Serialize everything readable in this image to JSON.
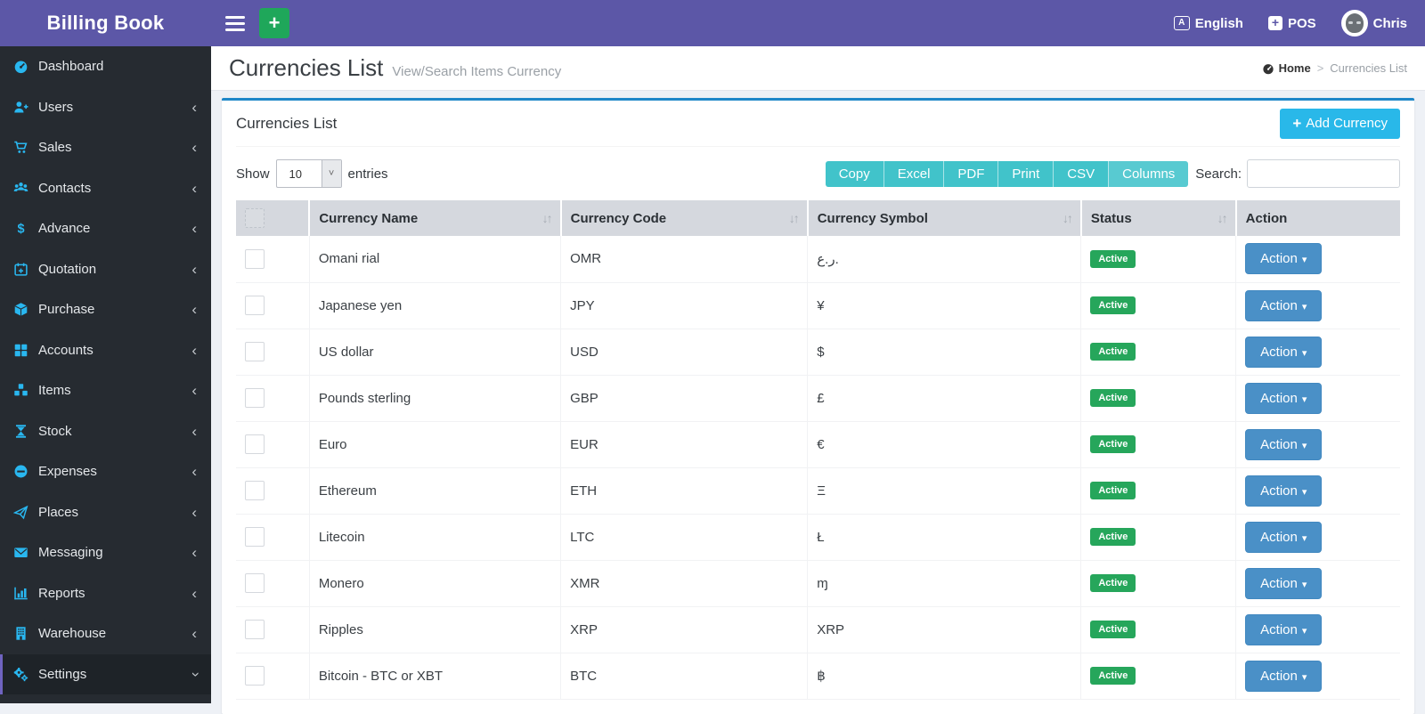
{
  "brand": {
    "title": "Billing Book"
  },
  "navbar": {
    "language_label": "English",
    "pos_label": "POS",
    "user_name": "Chris"
  },
  "sidebar": {
    "items": [
      {
        "label": "Dashboard",
        "icon": "tachometer",
        "chevron": "none",
        "active": false
      },
      {
        "label": "Users",
        "icon": "user-plus",
        "chevron": "left",
        "active": false
      },
      {
        "label": "Sales",
        "icon": "cart",
        "chevron": "left",
        "active": false
      },
      {
        "label": "Contacts",
        "icon": "users",
        "chevron": "left",
        "active": false
      },
      {
        "label": "Advance",
        "icon": "dollar",
        "chevron": "left",
        "active": false
      },
      {
        "label": "Quotation",
        "icon": "calendar-plus",
        "chevron": "left",
        "active": false
      },
      {
        "label": "Purchase",
        "icon": "cube",
        "chevron": "left",
        "active": false
      },
      {
        "label": "Accounts",
        "icon": "grid",
        "chevron": "left",
        "active": false
      },
      {
        "label": "Items",
        "icon": "cubes",
        "chevron": "left",
        "active": false
      },
      {
        "label": "Stock",
        "icon": "hourglass",
        "chevron": "left",
        "active": false
      },
      {
        "label": "Expenses",
        "icon": "minus-circle",
        "chevron": "left",
        "active": false
      },
      {
        "label": "Places",
        "icon": "paper-plane",
        "chevron": "left",
        "active": false
      },
      {
        "label": "Messaging",
        "icon": "envelope",
        "chevron": "left",
        "active": false
      },
      {
        "label": "Reports",
        "icon": "bar-chart",
        "chevron": "left",
        "active": false
      },
      {
        "label": "Warehouse",
        "icon": "building",
        "chevron": "left",
        "active": false
      },
      {
        "label": "Settings",
        "icon": "gears",
        "chevron": "down",
        "active": true
      }
    ]
  },
  "page_header": {
    "title": "Currencies List",
    "subtitle": "View/Search Items Currency",
    "breadcrumb": {
      "home": "Home",
      "separator": ">",
      "current": "Currencies List"
    }
  },
  "card": {
    "title": "Currencies List",
    "add_button_label": "Add Currency",
    "show_label": "Show",
    "page_size": "10",
    "entries_label": "entries",
    "export_buttons": [
      "Copy",
      "Excel",
      "PDF",
      "Print",
      "CSV",
      "Columns"
    ],
    "search_label": "Search:",
    "search_value": ""
  },
  "table": {
    "columns": [
      "Currency Name",
      "Currency Code",
      "Currency Symbol",
      "Status",
      "Action"
    ],
    "sort_icon": "↓↑",
    "action_label": "Action",
    "rows": [
      {
        "name": "Omani rial",
        "code": "OMR",
        "symbol": "ر.ع.",
        "status": "Active"
      },
      {
        "name": "Japanese yen",
        "code": "JPY",
        "symbol": "¥",
        "status": "Active"
      },
      {
        "name": "US dollar",
        "code": "USD",
        "symbol": "$",
        "status": "Active"
      },
      {
        "name": "Pounds sterling",
        "code": "GBP",
        "symbol": "£",
        "status": "Active"
      },
      {
        "name": "Euro",
        "code": "EUR",
        "symbol": "€",
        "status": "Active"
      },
      {
        "name": "Ethereum",
        "code": "ETH",
        "symbol": "Ξ",
        "status": "Active"
      },
      {
        "name": "Litecoin",
        "code": "LTC",
        "symbol": "Ł",
        "status": "Active"
      },
      {
        "name": "Monero",
        "code": "XMR",
        "symbol": "ɱ",
        "status": "Active"
      },
      {
        "name": "Ripples",
        "code": "XRP",
        "symbol": "XRP",
        "status": "Active"
      },
      {
        "name": "Bitcoin - BTC or XBT",
        "code": "BTC",
        "symbol": "฿",
        "status": "Active"
      }
    ]
  },
  "colors": {
    "navbar_purple": "#5c57a7",
    "sidebar_dark": "#262b31",
    "sidebar_icon_accent": "#29b7f0",
    "sidebar_active_border": "#6f63c0",
    "card_top_border": "#1e87c8",
    "add_button": "#29b8e9",
    "export_button": "#41c3ca",
    "action_button": "#4a90c7",
    "status_active_green": "#26a65b",
    "navbar_plus_green": "#1fa75a",
    "table_header_bg": "#d5d8de"
  }
}
